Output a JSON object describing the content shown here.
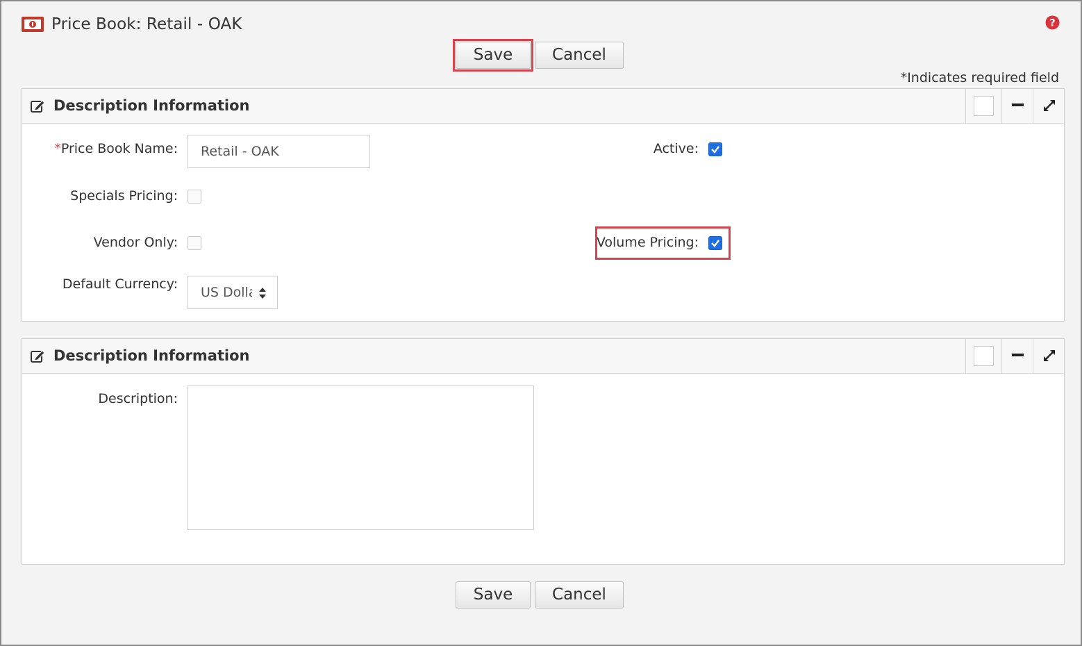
{
  "header": {
    "title": "Price Book: Retail - OAK",
    "required_note": "*Indicates required field"
  },
  "toolbar": {
    "save_label": "Save",
    "cancel_label": "Cancel"
  },
  "panels": [
    {
      "title": "Description Information",
      "fields": {
        "price_book_name": {
          "required_mark": "*",
          "label": "Price Book Name:",
          "value": "Retail - OAK"
        },
        "active": {
          "label": "Active:",
          "checked": true
        },
        "specials_pricing": {
          "label": "Specials Pricing:",
          "checked": false
        },
        "vendor_only": {
          "label": "Vendor Only:",
          "checked": false
        },
        "volume_pricing": {
          "label": "Volume Pricing:",
          "checked": true
        },
        "default_currency": {
          "label": "Default Currency:",
          "value": "US Dolla"
        }
      }
    },
    {
      "title": "Description Information",
      "fields": {
        "description": {
          "label": "Description:",
          "value": ""
        }
      }
    }
  ],
  "footer": {
    "save_label": "Save",
    "cancel_label": "Cancel"
  },
  "colors": {
    "highlight": "#d9434b",
    "checkbox_accent": "#1f6fe0",
    "required": "#d9434b"
  },
  "icons": {
    "page": "price-book-icon",
    "help": "help-icon",
    "panel": "edit-icon",
    "minimize": "minus-icon",
    "expand": "expand-icon"
  }
}
